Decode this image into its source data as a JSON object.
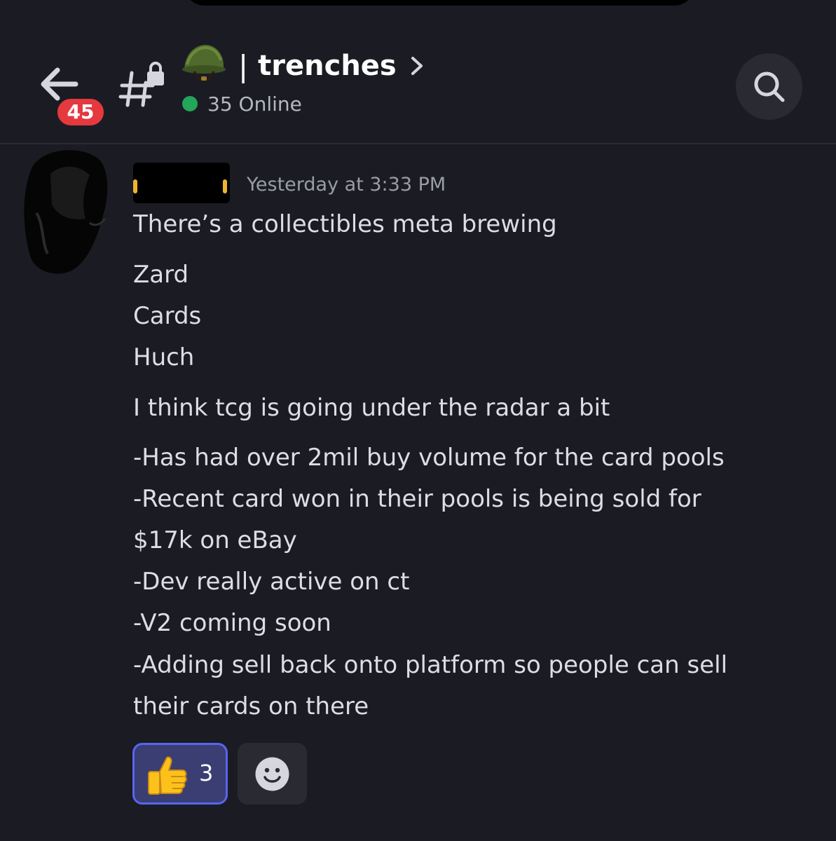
{
  "header": {
    "unread_badge": "45",
    "channel_title": "trenches",
    "title_separator": "|",
    "online_text": "35 Online",
    "icons": {
      "back": "arrow-left-icon",
      "channel": "locked-text-channel-icon",
      "channel_emoji": "military-helmet-emoji",
      "title_chevron": "chevron-right-icon",
      "search": "search-icon"
    },
    "colors": {
      "badge": "#e5393f",
      "online_dot": "#23a55a"
    }
  },
  "message": {
    "timestamp": "Yesterday at 3:33 PM",
    "lines": [
      "There’s a collectibles meta brewing",
      "Zard",
      "Cards",
      "Huch",
      "I think tcg is going under the radar a bit",
      "-Has had over 2mil buy volume for the card pools",
      "-Recent card won in their pools is being sold for",
      "$17k on eBay",
      "-Dev really active on ct",
      "-V2 coming soon",
      "-Adding sell back onto platform so people can sell",
      "their cards on there"
    ],
    "username_color": "#f0b232"
  },
  "reactions": [
    {
      "emoji": "thumbs-up-emoji",
      "count": "3",
      "selected": true
    }
  ],
  "add_reaction_icon": "smiley-face-icon",
  "theme": {
    "background": "#1b1c23",
    "reaction_selected_border": "#5865f2"
  }
}
